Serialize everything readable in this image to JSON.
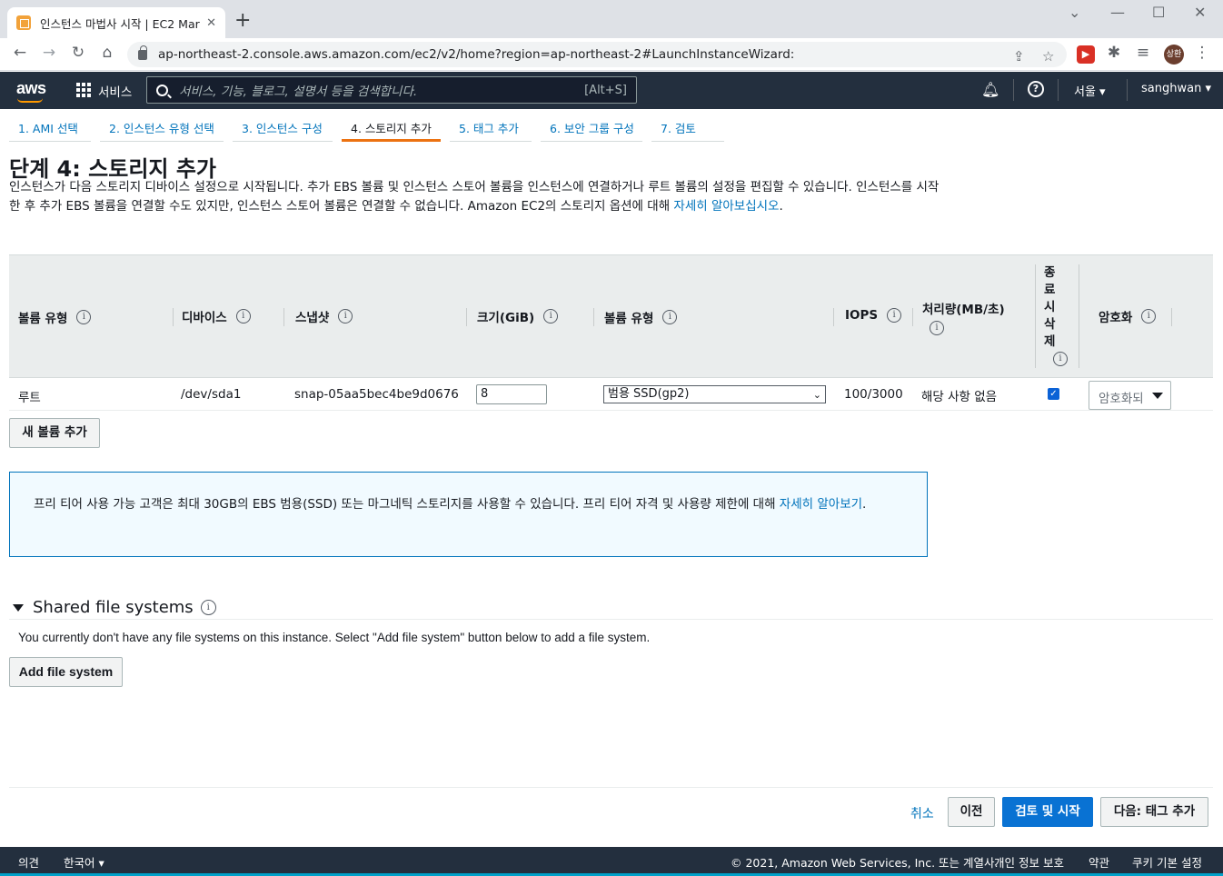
{
  "browser": {
    "tab_title": "인스턴스 마법사 시작 | EC2 Mar",
    "tab_close": "✕",
    "new_tab": "+",
    "url": "ap-northeast-2.console.aws.amazon.com/ec2/v2/home?region=ap-northeast-2#LaunchInstanceWizard:",
    "profile": "상환",
    "window_controls": [
      "⌄",
      "—",
      "☐",
      "✕"
    ],
    "icons": [
      "back-icon",
      "forward-icon",
      "reload-icon",
      "home-icon",
      "share-icon",
      "star-icon",
      "puzzle-icon",
      "reading-list-icon",
      "menu-icon"
    ]
  },
  "aws_header": {
    "logo": "aws",
    "services": "서비스",
    "search_placeholder": "서비스, 기능, 블로그, 설명서 등을 검색합니다.",
    "search_hint": "[Alt+S]",
    "region": "서울 ▾",
    "user": "sanghwan ▾"
  },
  "steps": [
    {
      "label": "1. AMI 선택",
      "active": false
    },
    {
      "label": "2. 인스턴스 유형 선택",
      "active": false
    },
    {
      "label": "3. 인스턴스 구성",
      "active": false
    },
    {
      "label": "4. 스토리지 추가",
      "active": true
    },
    {
      "label": "5. 태그 추가",
      "active": false
    },
    {
      "label": "6. 보안 그룹 구성",
      "active": false
    },
    {
      "label": "7. 검토",
      "active": false
    }
  ],
  "page": {
    "title": "단계 4: 스토리지 추가",
    "description": "인스턴스가 다음 스토리지 디바이스 설정으로 시작됩니다. 추가 EBS 볼륨 및 인스턴스 스토어 볼륨을 인스턴스에 연결하거나 루트 볼륨의 설정을 편집할 수 있습니다. 인스턴스를 시작한 후 추가 EBS 볼륨을 연결할 수도 있지만, 인스턴스 스토어 볼륨은 연결할 수 없습니다. Amazon EC2의 스토리지 옵션에 대해 ",
    "description_link": "자세히 알아보십시오",
    "description_end": "."
  },
  "table": {
    "headers": {
      "volume_type": "볼륨 유형",
      "device": "디바이스",
      "snapshot": "스냅샷",
      "size": "크기(GiB)",
      "ebs_type": "볼륨 유형",
      "iops": "IOPS",
      "throughput": "처리량(MB/초)",
      "delete_on_termination": "종료시삭제",
      "encryption": "암호화"
    },
    "info_icon": "i",
    "rows": [
      {
        "volume_type": "루트",
        "device": "/dev/sda1",
        "snapshot": "snap-05aa5bec4be9d0676",
        "size": "8",
        "ebs_type": "범용 SSD(gp2)",
        "iops": "100/3000",
        "throughput": "해당 사항 없음",
        "delete_on_termination": true,
        "encryption": "암호화되"
      }
    ]
  },
  "add_volume_button": "새 볼륨 추가",
  "free_tier": {
    "text": "프리 티어 사용 가능 고객은 최대 30GB의 EBS 범용(SSD) 또는 마그네틱 스토리지를 사용할 수 있습니다. 프리 티어 자격 및 사용량 제한에 대해 ",
    "link": "자세히 알아보기",
    "end": "."
  },
  "shared_fs": {
    "title": "Shared file systems",
    "note": "You currently don't have any file systems on this instance. Select \"Add file system\" button below to add a file system.",
    "button": "Add file system"
  },
  "actions": {
    "cancel": "취소",
    "previous": "이전",
    "review_launch": "검토 및 시작",
    "next": "다음: 태그 추가"
  },
  "footer": {
    "feedback": "의견",
    "language": "한국어 ▾",
    "copyright": "© 2021, Amazon Web Services, Inc. 또는 계열사.",
    "privacy": "개인 정보 보호",
    "terms": "약관",
    "cookies": "쿠키 기본 설정"
  },
  "colors": {
    "aws_dark": "#232f3e",
    "accent_orange": "#ec7211",
    "link_blue": "#0073bb",
    "primary_button": "#0972d3"
  }
}
